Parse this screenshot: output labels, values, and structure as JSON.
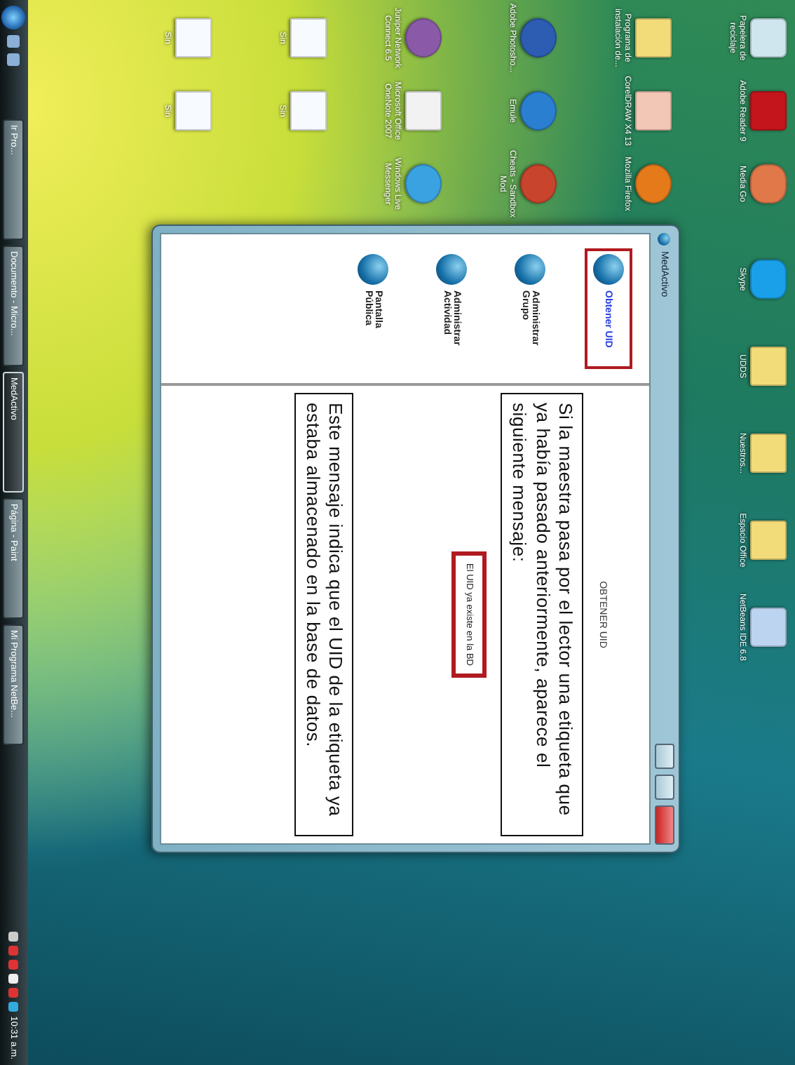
{
  "desktop_icons": [
    {
      "kind": "recycle",
      "label": "Papelera de reciclaje"
    },
    {
      "kind": "folder",
      "label": "Programa de instalación de..."
    },
    {
      "kind": "camera",
      "label": "Adobe Photosho..."
    },
    {
      "kind": "disc",
      "label": "Juniper Network Connect 6.5"
    },
    {
      "kind": "document",
      "label": "Sin"
    },
    {
      "kind": "document",
      "label": "Sin"
    },
    {
      "kind": "pdf",
      "label": "Adobe Reader 9"
    },
    {
      "kind": "photos",
      "label": "CorelDRAW X4 13"
    },
    {
      "kind": "globe",
      "label": "Emule"
    },
    {
      "kind": "letter",
      "label": "Microsoft Office OneNote 2007"
    },
    {
      "kind": "document",
      "label": "Sin"
    },
    {
      "kind": "document",
      "label": "Sin"
    },
    {
      "kind": "wave",
      "label": "Media Go"
    },
    {
      "kind": "fox",
      "label": "Mozilla Firefox"
    },
    {
      "kind": "ball",
      "label": "Cheats - Sandbox Mod"
    },
    {
      "kind": "chat",
      "label": "Windows Live Messenger"
    }
  ],
  "top_icons": [
    {
      "kind": "skype",
      "label": "Skype"
    },
    {
      "kind": "folder",
      "label": "UDDS"
    },
    {
      "kind": "folder",
      "label": "Nuestros..."
    },
    {
      "kind": "folder",
      "label": "Espacio Office"
    },
    {
      "kind": "cube",
      "label": "NetBeans IDE 6.8"
    }
  ],
  "window": {
    "title": "MedActivo",
    "menu": [
      {
        "label": "Obtener UID",
        "selected": true
      },
      {
        "label": "Administrar Grupo",
        "selected": false
      },
      {
        "label": "Administrar Actividad",
        "selected": false
      },
      {
        "label": "Pantalla Pública",
        "selected": false
      }
    ],
    "heading": "OBTENER UID",
    "message": "El UID ya existe en la BD"
  },
  "annotations": [
    "Si la maestra pasa por el lector una etiqueta que ya había pasado anteriormente, aparece el siguiente mensaje:",
    "Este mensaje indica que el UID de la etiqueta ya estaba almacenado en la base de datos."
  ],
  "taskbar": {
    "tasks": [
      {
        "label": "Ir Pro...",
        "selected": false
      },
      {
        "label": "Documento - Micro...",
        "selected": false
      },
      {
        "label": "MedActivo",
        "selected": true
      },
      {
        "label": "Página - Paint",
        "selected": false
      },
      {
        "label": "Mi Programa NetBe...",
        "selected": false
      }
    ],
    "clock": "10:31 a.m."
  }
}
